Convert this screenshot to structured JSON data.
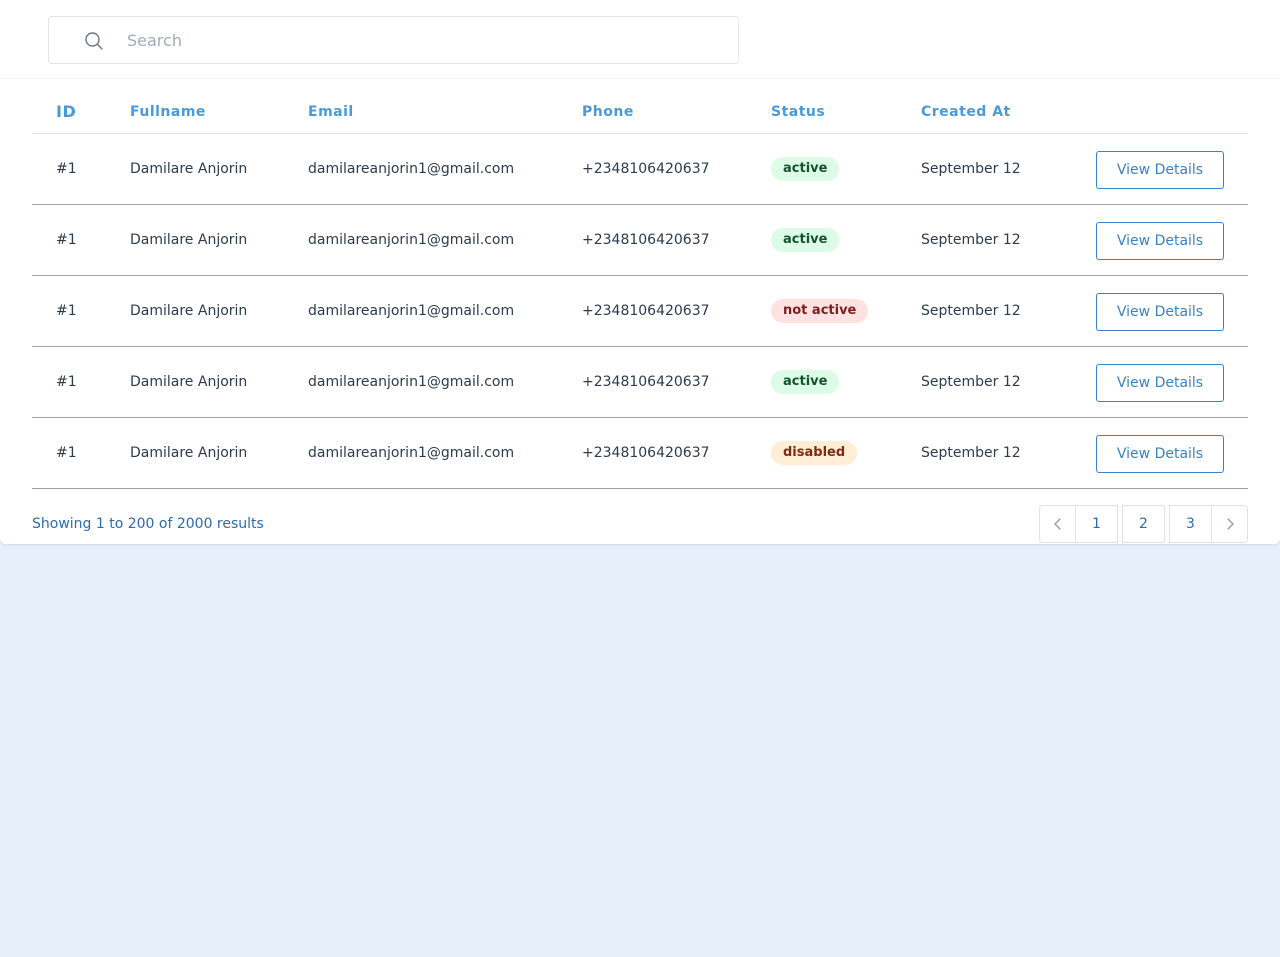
{
  "search": {
    "placeholder": "Search",
    "value": ""
  },
  "table": {
    "columns": {
      "id": "ID",
      "fullname": "Fullname",
      "email": "Email",
      "phone": "Phone",
      "status": "Status",
      "created_at": "Created At"
    },
    "rows": [
      {
        "id": "#1",
        "fullname": "Damilare Anjorin",
        "email": "damilareanjorin1@gmail.com",
        "phone": "+2348106420637",
        "status": "active",
        "created_at": "September 12",
        "action": "View Details"
      },
      {
        "id": "#1",
        "fullname": "Damilare Anjorin",
        "email": "damilareanjorin1@gmail.com",
        "phone": "+2348106420637",
        "status": "active",
        "created_at": "September 12",
        "action": "View Details"
      },
      {
        "id": "#1",
        "fullname": "Damilare Anjorin",
        "email": "damilareanjorin1@gmail.com",
        "phone": "+2348106420637",
        "status": "not active",
        "created_at": "September 12",
        "action": "View Details"
      },
      {
        "id": "#1",
        "fullname": "Damilare Anjorin",
        "email": "damilareanjorin1@gmail.com",
        "phone": "+2348106420637",
        "status": "active",
        "created_at": "September 12",
        "action": "View Details"
      },
      {
        "id": "#1",
        "fullname": "Damilare Anjorin",
        "email": "damilareanjorin1@gmail.com",
        "phone": "+2348106420637",
        "status": "disabled",
        "created_at": "September 12",
        "action": "View Details"
      }
    ]
  },
  "footer": {
    "results_text": "Showing 1 to 200 of 2000 results",
    "pages": [
      "1",
      "2",
      "3"
    ],
    "prev_icon": "chevron-left-icon",
    "next_icon": "chevron-right-icon"
  },
  "colors": {
    "page_background": "#e7f0fa",
    "header_text": "#4a9ad9",
    "link": "#2b6cb0",
    "status_active_bg": "#dcfce7",
    "status_not_active_bg": "#fee2e2",
    "status_disabled_bg": "#ffedd5"
  }
}
